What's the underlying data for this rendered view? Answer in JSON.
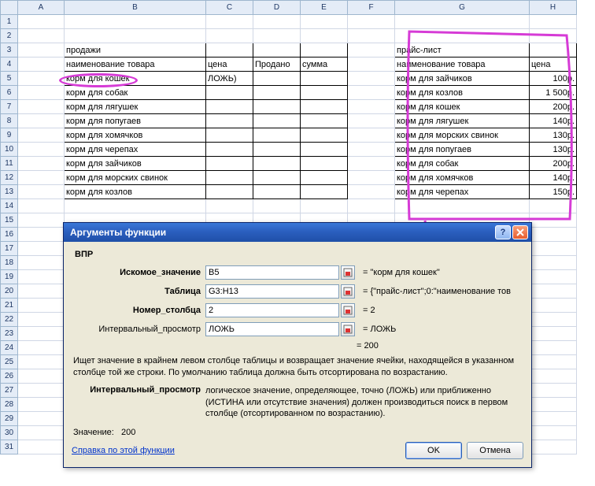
{
  "columns": [
    "A",
    "B",
    "C",
    "D",
    "E",
    "F",
    "G",
    "H"
  ],
  "rows": [
    "1",
    "2",
    "3",
    "4",
    "5",
    "6",
    "7",
    "8",
    "9",
    "10",
    "11",
    "12",
    "13",
    "14",
    "15",
    "16",
    "17",
    "18",
    "19",
    "20",
    "21",
    "22",
    "23",
    "24",
    "25",
    "26",
    "27",
    "28",
    "29",
    "30",
    "31"
  ],
  "left": {
    "title": "продажи",
    "headers": {
      "name": "наименование товара",
      "price": "цена",
      "sold": "Продано",
      "sum": "сумма"
    },
    "c5": "ЛОЖЬ)",
    "items": [
      "корм для кошек",
      "корм для собак",
      "корм для лягушек",
      "корм для попугаев",
      "корм для хомячков",
      "корм для черепах",
      "корм для зайчиков",
      "корм для морских свинок",
      "корм для козлов"
    ]
  },
  "right": {
    "title": "прайс-лист",
    "headers": {
      "name": "наименование товара",
      "price": "цена"
    },
    "rows": [
      {
        "name": "корм для зайчиков",
        "price": "100р."
      },
      {
        "name": "корм для козлов",
        "price": "1 500р."
      },
      {
        "name": "корм для кошек",
        "price": "200р."
      },
      {
        "name": "корм для лягушек",
        "price": "140р."
      },
      {
        "name": "корм для морских свинок",
        "price": "130р."
      },
      {
        "name": "корм для попугаев",
        "price": "130р."
      },
      {
        "name": "корм для собак",
        "price": "200р."
      },
      {
        "name": "корм для хомячков",
        "price": "140р."
      },
      {
        "name": "корм для черепах",
        "price": "150р."
      }
    ]
  },
  "dialog": {
    "title": "Аргументы функции",
    "fn": "ВПР",
    "args": {
      "lookup_label": "Искомое_значение",
      "lookup_value": "B5",
      "lookup_eval": "= \"корм для кошек\"",
      "table_label": "Таблица",
      "table_value": "G3:H13",
      "table_eval": "= {\"прайс-лист\";0:\"наименование тов",
      "col_label": "Номер_столбца",
      "col_value": "2",
      "col_eval": "= 2",
      "range_label": "Интервальный_просмотр",
      "range_value": "ЛОЖЬ",
      "range_eval": "= ЛОЖЬ"
    },
    "result_eq": "= 200",
    "desc": "Ищет значение в крайнем левом столбце таблицы и возвращает значение ячейки, находящейся в указанном столбце той же строки. По умолчанию таблица должна быть отсортирована по возрастанию.",
    "arg_desc_label": "Интервальный_просмотр",
    "arg_desc_text": "логическое значение, определяющее, точно (ЛОЖЬ) или приближенно (ИСТИНА или отсутствие значения) должен производиться поиск в первом столбце (отсортированном по возрастанию).",
    "value_label": "Значение:",
    "value": "200",
    "help": "Справка по этой функции",
    "ok": "OK",
    "cancel": "Отмена"
  }
}
